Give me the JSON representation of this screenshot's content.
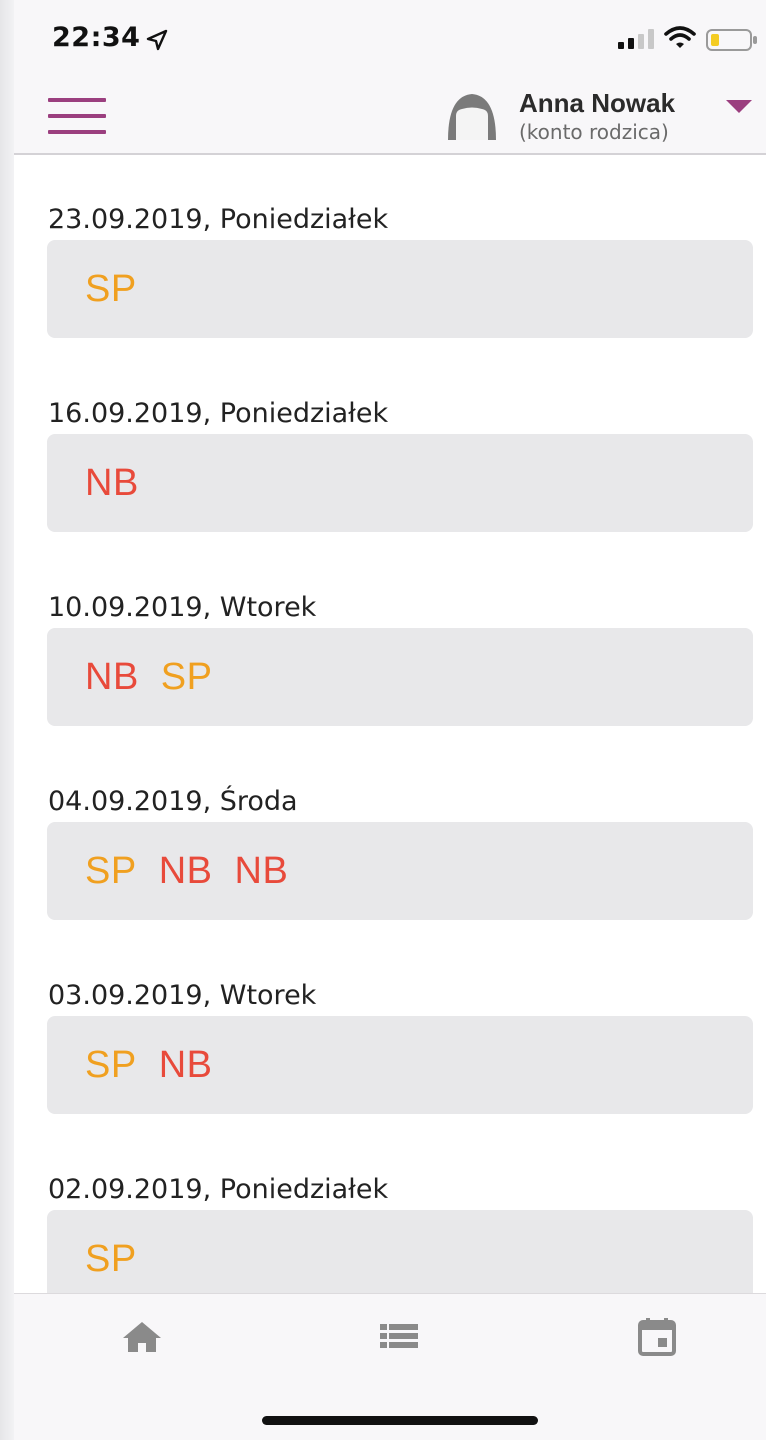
{
  "status_bar": {
    "time": "22:34",
    "icons": [
      "location-arrow-icon",
      "signal-bars-icon",
      "wifi-icon",
      "battery-low-icon"
    ]
  },
  "header": {
    "menu_icon": "hamburger-menu-icon",
    "avatar_icon": "user-avatar-icon",
    "user_name": "Anna Nowak",
    "user_role": "(konto rodzica)",
    "dropdown_icon": "caret-down-icon"
  },
  "entries": [
    {
      "date": "23.09.2019, Poniedziałek",
      "marks": [
        "SP"
      ]
    },
    {
      "date": "16.09.2019, Poniedziałek",
      "marks": [
        "NB"
      ]
    },
    {
      "date": "10.09.2019, Wtorek",
      "marks": [
        "NB",
        "SP"
      ]
    },
    {
      "date": "04.09.2019, Środa",
      "marks": [
        "SP",
        "NB",
        "NB"
      ]
    },
    {
      "date": "03.09.2019, Wtorek",
      "marks": [
        "SP",
        "NB"
      ]
    },
    {
      "date": "02.09.2019, Poniedziałek",
      "marks": [
        "SP"
      ]
    }
  ],
  "bottom_nav": {
    "items": [
      {
        "icon": "home-icon"
      },
      {
        "icon": "list-icon"
      },
      {
        "icon": "calendar-icon"
      }
    ]
  },
  "colors": {
    "accent": "#9b3f7f",
    "mark_sp": "#f0a020",
    "mark_nb": "#e84a3b",
    "card_background": "#e8e8ea",
    "nav_icon": "#8a8a8a"
  }
}
